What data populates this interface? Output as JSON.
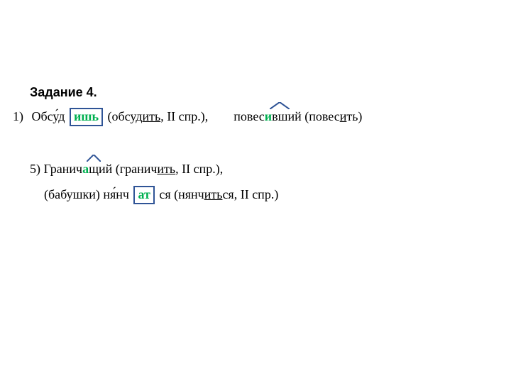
{
  "title": "Задание 4.",
  "line1": {
    "num": "1)",
    "a_pre": "Обсу́д",
    "a_ins": "ишь",
    "a_paren_pre": " (обсуд",
    "a_paren_u": "ить",
    "a_paren_post": ", II спр.),",
    "gap": "      ",
    "b_pre": "повес",
    "b_ins_letter": "и",
    "b_suffix": "вш",
    "b_post": "ий (повес",
    "b_u": "и",
    "b_end": "ть)"
  },
  "line5": {
    "num": "5)",
    "pre": " Гранич",
    "ins_letter": "а",
    "suffix": "щ",
    "post": "ий (гранич",
    "u": "ить",
    "end": ", II спр.),"
  },
  "line5b": {
    "pre": "(бабушки) ня́нч",
    "ins": "ат",
    "post": "ся (нянч",
    "u": "ить",
    "end": "ся, II спр.)"
  }
}
